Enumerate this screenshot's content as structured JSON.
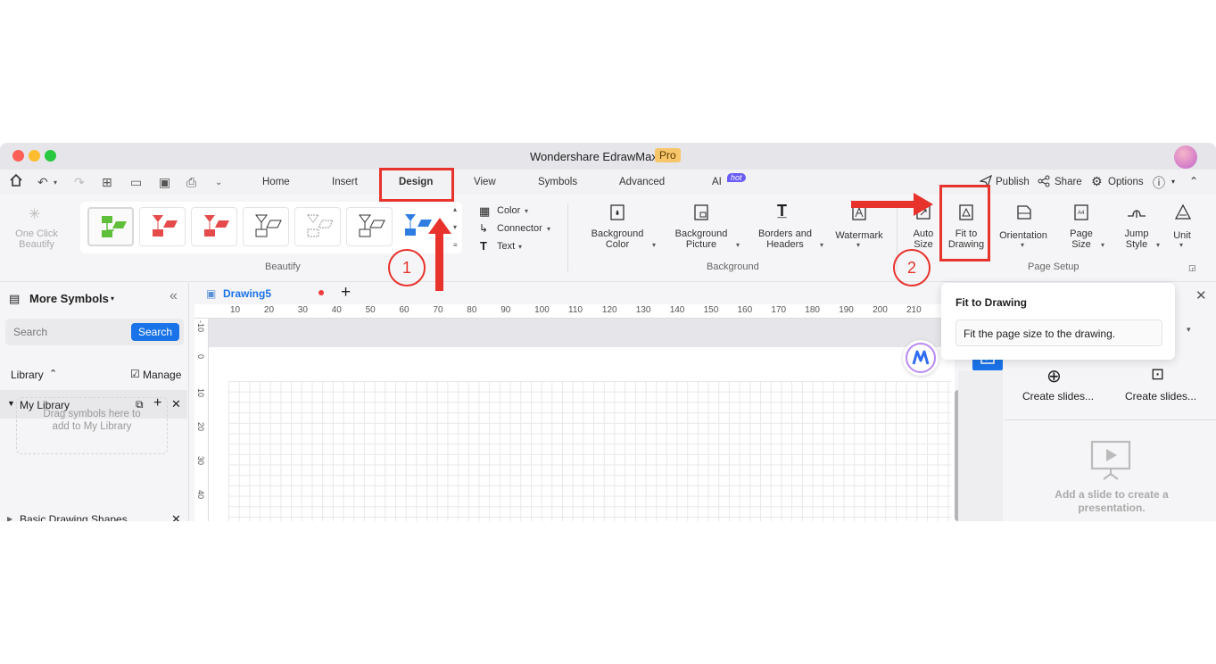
{
  "window": {
    "title": "Wondershare EdrawMax",
    "badge": "Pro"
  },
  "menu": {
    "tabs": [
      "Home",
      "Insert",
      "Design",
      "View",
      "Symbols",
      "Advanced",
      "AI"
    ],
    "ai_badge": "hot",
    "right": {
      "publish": "Publish",
      "share": "Share",
      "options": "Options"
    }
  },
  "ribbon": {
    "one_click": "One Click Beautify",
    "beautify_group": "Beautify",
    "color": "Color",
    "connector": "Connector",
    "text": "Text",
    "background_color": "Background Color",
    "background_picture": "Background Picture",
    "borders_headers": "Borders and Headers",
    "watermark": "Watermark",
    "background_group": "Background",
    "auto_size": "Auto Size",
    "fit_to_drawing": "Fit to Drawing",
    "orientation": "Orientation",
    "page_size": "Page Size",
    "jump_style": "Jump Style",
    "unit": "Unit",
    "page_setup_group": "Page Setup"
  },
  "tooltip": {
    "title": "Fit to Drawing",
    "text": "Fit the page size to the drawing."
  },
  "left_panel": {
    "title": "More Symbols",
    "search_placeholder": "Search",
    "search_button": "Search",
    "library": "Library",
    "manage": "Manage",
    "my_library": "My Library",
    "drop_hint": "Drag symbols here to add to My Library",
    "basic_shapes": "Basic Drawing Shapes"
  },
  "document": {
    "tab": "Drawing5"
  },
  "ruler": {
    "h_ticks": [
      "10",
      "20",
      "30",
      "40",
      "50",
      "60",
      "70",
      "80",
      "90",
      "100",
      "110",
      "120",
      "130",
      "140",
      "150",
      "160",
      "170",
      "180",
      "190",
      "200",
      "210"
    ],
    "v_ticks": [
      "-10",
      "0",
      "10",
      "20",
      "30",
      "40"
    ]
  },
  "right_panel": {
    "create_slides_1": "Create slides...",
    "create_slides_2": "Create slides...",
    "empty_msg": "Add a slide to create a presentation."
  },
  "annotations": {
    "step1": "1",
    "step2": "2"
  },
  "colors": {
    "accent": "#1a73e8",
    "annotation": "#e8322c",
    "pro_badge": "#f7c66b"
  }
}
